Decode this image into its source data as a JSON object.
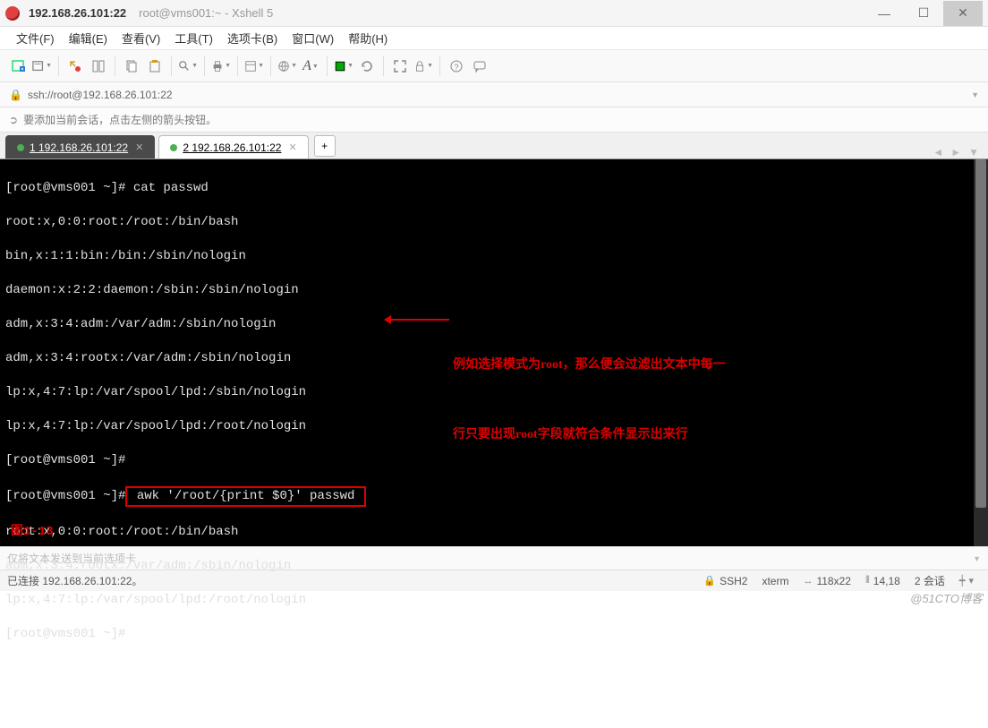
{
  "window": {
    "host": "192.168.26.101:22",
    "subtitle": "root@vms001:~ - Xshell 5"
  },
  "menus": [
    "文件(F)",
    "编辑(E)",
    "查看(V)",
    "工具(T)",
    "选项卡(B)",
    "窗口(W)",
    "帮助(H)"
  ],
  "address": "ssh://root@192.168.26.101:22",
  "hint": "要添加当前会话，点击左侧的箭头按钮。",
  "tabs": [
    {
      "label": "1 192.168.26.101:22",
      "active": true
    },
    {
      "label": "2 192.168.26.101:22",
      "active": false
    }
  ],
  "terminal": {
    "lines": [
      "[root@vms001 ~]# cat passwd",
      "root:x,0:0:root:/root:/bin/bash",
      "bin,x:1:1:bin:/bin:/sbin/nologin",
      "daemon:x:2:2:daemon:/sbin:/sbin/nologin",
      "adm,x:3:4:adm:/var/adm:/sbin/nologin",
      "adm,x:3:4:rootx:/var/adm:/sbin/nologin",
      "lp:x,4:7:lp:/var/spool/lpd:/sbin/nologin",
      "lp:x,4:7:lp:/var/spool/lpd:/root/nologin",
      "[root@vms001 ~]#"
    ],
    "highlighted_prompt": "[root@vms001 ~]#",
    "highlighted_cmd": " awk '/root/{print $0}' passwd ",
    "post_lines": [
      "root:x,0:0:root:/root:/bin/bash",
      "adm,x:3:4:rootx:/var/adm:/sbin/nologin",
      "lp:x,4:7:lp:/var/spool/lpd:/root/nologin",
      "[root@vms001 ~]# "
    ],
    "figure_label": "图1-13"
  },
  "annotation": {
    "line1": "例如选择模式为root，那么便会过滤出文本中每一",
    "line2": "行只要出现root字段就符合条件显示出来行"
  },
  "input_placeholder": "仅将文本发送到当前选项卡",
  "status": {
    "connected": "已连接 192.168.26.101:22。",
    "proto": "SSH2",
    "term": "xterm",
    "size": "118x22",
    "pos": "14,18",
    "sessions": "2 会话"
  },
  "watermark": "@51CTO博客"
}
